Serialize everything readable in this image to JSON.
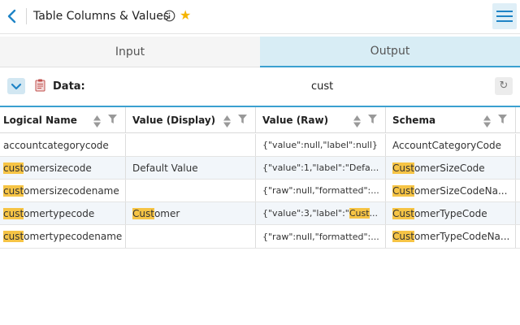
{
  "header": {
    "title": "Table Columns & Values",
    "back_icon": "chevron-left-icon",
    "info_icon": "info-icon",
    "favorite_icon": "star-icon",
    "menu_icon": "hamburger-icon",
    "accent_color": "#1f84c6",
    "star_color": "#f5b400"
  },
  "tabs": [
    {
      "label": "Input",
      "active": false
    },
    {
      "label": "Output",
      "active": true
    }
  ],
  "databar": {
    "label": "Data:",
    "search_value": "cust",
    "collapse_icon": "chevron-down-icon",
    "doc_icon": "clipboard-icon",
    "refresh_icon": "refresh-icon",
    "refresh_glyph": "↻"
  },
  "table": {
    "highlight_color": "#f6c445",
    "columns": [
      "Logical Name",
      "Value (Display)",
      "Value (Raw)",
      "Schema"
    ],
    "rows": [
      {
        "logical": "accountcategorycode",
        "display": "",
        "raw": "{\"value\":null,\"label\":null}",
        "schema": "AccountCategoryCode"
      },
      {
        "logical": "customersizecode",
        "display": "Default Value",
        "raw": "{\"value\":1,\"label\":\"Defa...",
        "schema": "CustomerSizeCode"
      },
      {
        "logical": "customersizecodename",
        "display": "",
        "raw": "{\"raw\":null,\"formatted\":...",
        "schema": "CustomerSizeCodeNa..."
      },
      {
        "logical": "customertypecode",
        "display": "Customer",
        "raw": "{\"value\":3,\"label\":\"Cust...",
        "schema": "CustomerTypeCode"
      },
      {
        "logical": "customertypecodename",
        "display": "",
        "raw": "{\"raw\":null,\"formatted\":...",
        "schema": "CustomerTypeCodeNa..."
      }
    ]
  }
}
